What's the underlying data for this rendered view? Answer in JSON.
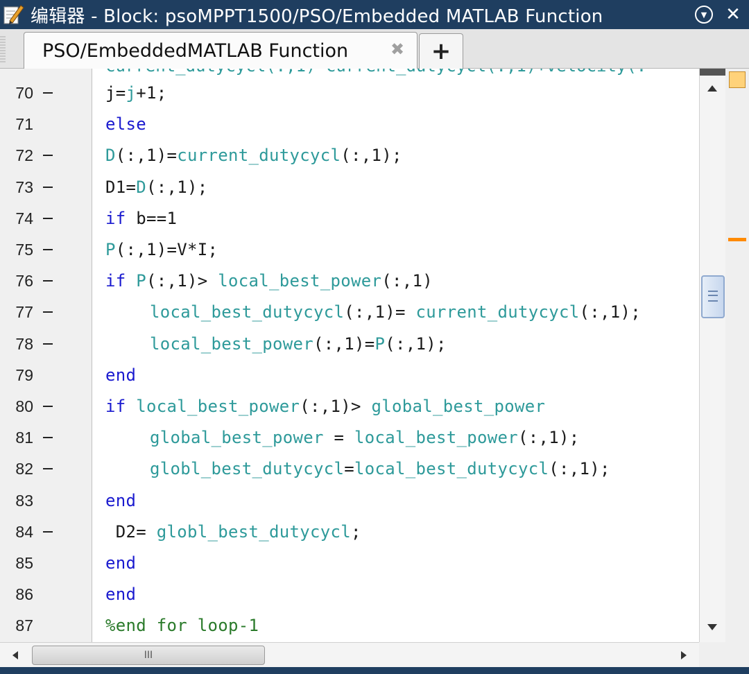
{
  "window": {
    "title": "编辑器 - Block: psoMPPT1500/PSO/Embedded MATLAB Function",
    "icon": "pencil-document-icon",
    "buttons": [
      "dropdown-circle-icon",
      "close-icon"
    ]
  },
  "tabs": {
    "active_label": "PSO/EmbeddedMATLAB Function",
    "close_glyph": "✖",
    "add_glyph": "+"
  },
  "editor": {
    "lines": [
      {
        "num": "70",
        "dash": true,
        "indent": 0,
        "segments": [
          {
            "t": "j=",
            "c": "tx"
          },
          {
            "t": "j",
            "c": "vr"
          },
          {
            "t": "+1;",
            "c": "tx"
          }
        ]
      },
      {
        "num": "71",
        "dash": false,
        "indent": 0,
        "segments": [
          {
            "t": "else",
            "c": "kw"
          }
        ]
      },
      {
        "num": "72",
        "dash": true,
        "indent": 0,
        "segments": [
          {
            "t": "D",
            "c": "vr"
          },
          {
            "t": "(:,1)=",
            "c": "tx"
          },
          {
            "t": "current_dutycycl",
            "c": "vr"
          },
          {
            "t": "(:,1);",
            "c": "tx"
          }
        ]
      },
      {
        "num": "73",
        "dash": true,
        "indent": 0,
        "segments": [
          {
            "t": "D1=",
            "c": "tx"
          },
          {
            "t": "D",
            "c": "vr"
          },
          {
            "t": "(:,1);",
            "c": "tx"
          }
        ]
      },
      {
        "num": "74",
        "dash": true,
        "indent": 0,
        "segments": [
          {
            "t": "if ",
            "c": "kw"
          },
          {
            "t": "b==1",
            "c": "tx"
          }
        ]
      },
      {
        "num": "75",
        "dash": true,
        "indent": 0,
        "segments": [
          {
            "t": "P",
            "c": "vr"
          },
          {
            "t": "(:,1)=V*I;",
            "c": "tx"
          }
        ]
      },
      {
        "num": "76",
        "dash": true,
        "indent": 0,
        "segments": [
          {
            "t": "if ",
            "c": "kw"
          },
          {
            "t": "P",
            "c": "vr"
          },
          {
            "t": "(:,1)> ",
            "c": "tx"
          },
          {
            "t": "local_best_power",
            "c": "vr"
          },
          {
            "t": "(:,1)",
            "c": "tx"
          }
        ]
      },
      {
        "num": "77",
        "dash": true,
        "indent": 1,
        "segments": [
          {
            "t": "local_best_dutycycl",
            "c": "vr"
          },
          {
            "t": "(:,1)= ",
            "c": "tx"
          },
          {
            "t": "current_dutycycl",
            "c": "vr"
          },
          {
            "t": "(:,1);",
            "c": "tx"
          }
        ]
      },
      {
        "num": "78",
        "dash": true,
        "indent": 1,
        "segments": [
          {
            "t": "local_best_power",
            "c": "vr"
          },
          {
            "t": "(:,1)=",
            "c": "tx"
          },
          {
            "t": "P",
            "c": "vr"
          },
          {
            "t": "(:,1);",
            "c": "tx"
          }
        ]
      },
      {
        "num": "79",
        "dash": false,
        "indent": 0,
        "segments": [
          {
            "t": "end",
            "c": "kw"
          }
        ]
      },
      {
        "num": "80",
        "dash": true,
        "indent": 0,
        "segments": [
          {
            "t": "if ",
            "c": "kw"
          },
          {
            "t": "local_best_power",
            "c": "vr"
          },
          {
            "t": "(:,1)> ",
            "c": "tx"
          },
          {
            "t": "global_best_power",
            "c": "vr"
          }
        ]
      },
      {
        "num": "81",
        "dash": true,
        "indent": 1,
        "segments": [
          {
            "t": "global_best_power",
            "c": "vr"
          },
          {
            "t": " = ",
            "c": "tx"
          },
          {
            "t": "local_best_power",
            "c": "vr"
          },
          {
            "t": "(:,1);",
            "c": "tx"
          }
        ]
      },
      {
        "num": "82",
        "dash": true,
        "indent": 1,
        "segments": [
          {
            "t": "globl_best_dutycycl",
            "c": "vr"
          },
          {
            "t": "=",
            "c": "tx"
          },
          {
            "t": "local_best_dutycycl",
            "c": "vr"
          },
          {
            "t": "(:,1);",
            "c": "tx"
          }
        ]
      },
      {
        "num": "83",
        "dash": false,
        "indent": 0,
        "segments": [
          {
            "t": "end",
            "c": "kw"
          }
        ]
      },
      {
        "num": "84",
        "dash": true,
        "indent": 0,
        "segments": [
          {
            "t": " D2= ",
            "c": "tx"
          },
          {
            "t": "globl_best_dutycycl",
            "c": "vr"
          },
          {
            "t": ";",
            "c": "tx"
          }
        ]
      },
      {
        "num": "85",
        "dash": false,
        "indent": 0,
        "segments": [
          {
            "t": "end",
            "c": "kw"
          }
        ]
      },
      {
        "num": "86",
        "dash": false,
        "indent": 0,
        "segments": [
          {
            "t": "end",
            "c": "kw"
          }
        ]
      },
      {
        "num": "87",
        "dash": false,
        "indent": 0,
        "segments": [
          {
            "t": "%end for loop-1",
            "c": "cm"
          }
        ]
      }
    ]
  },
  "scrollbars": {
    "horizontal_thumb_glyph": "III",
    "vertical_thumb_icon": "grip-lines-icon"
  },
  "colors": {
    "titlebar": "#1f3e60",
    "keyword": "#1a1acf",
    "variable": "#2e9a9a",
    "comment": "#2a7a2a",
    "marker": "#ff8a00"
  }
}
